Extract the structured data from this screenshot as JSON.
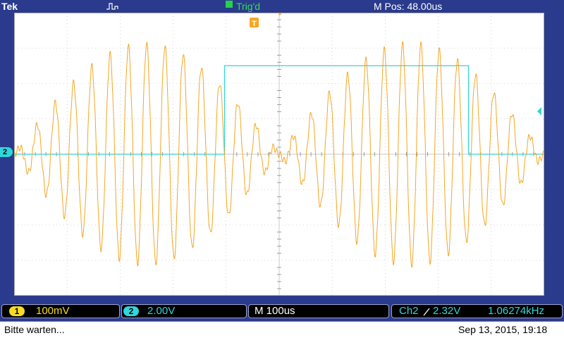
{
  "header": {
    "brand": "Tek",
    "trigger_status": "Trig'd",
    "position_label": "M Pos: 48.00us"
  },
  "markers": {
    "trigger_marker": "T",
    "channel2_marker": "2"
  },
  "readouts": {
    "ch1_number": "1",
    "ch1_scale": "100mV",
    "ch2_number": "2",
    "ch2_scale": "2.00V",
    "timebase": "M 100us",
    "trigger_source": "Ch2",
    "trigger_level": "2.32V",
    "frequency": "1.06274kHz"
  },
  "status": {
    "message": "Bitte warten...",
    "timestamp": "Sep 13, 2015, 19:18"
  },
  "colors": {
    "ch1": "#f5a623",
    "ch2": "#2fd6dc",
    "grid": "#c8c8c8",
    "screen_bg": "#ffffff",
    "frame_bg": "#2a3a8c",
    "trigger_green": "#31e052",
    "trigger_orange": "#f5a623"
  },
  "chart_data": {
    "type": "line",
    "xlabel": "",
    "ylabel": "",
    "grid": true,
    "divisions": {
      "x": 10,
      "y": 8
    },
    "xlim": [
      -452,
      548
    ],
    "x_unit": "us",
    "series": [
      {
        "channel": "1",
        "volts_per_div": 0.1,
        "shape": "burst sine, envelope maxima near -300us and +300us, envelope nulls near -452us, 0us, +548us",
        "carrier_frequency_hz": 29000,
        "peak_amplitude_v": 0.31
      },
      {
        "channel": "2",
        "volts_per_div": 2.0,
        "shape": "square pulse",
        "x": [
          -452,
          -55,
          -55,
          405,
          405,
          548
        ],
        "y": [
          0,
          0,
          5.0,
          5.0,
          0,
          0
        ]
      }
    ]
  }
}
